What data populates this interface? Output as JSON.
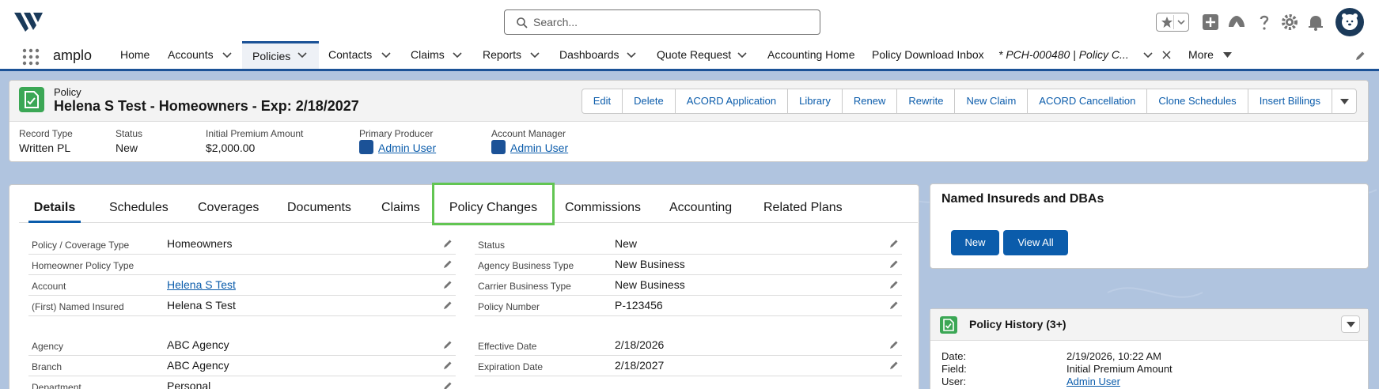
{
  "header": {
    "search_placeholder": "Search..."
  },
  "nav": {
    "app_name": "amplo",
    "items": [
      {
        "label": "Home"
      },
      {
        "label": "Accounts"
      },
      {
        "label": "Policies"
      },
      {
        "label": "Contacts"
      },
      {
        "label": "Claims"
      },
      {
        "label": "Reports"
      },
      {
        "label": "Dashboards"
      },
      {
        "label": "Quote Request"
      },
      {
        "label": "Accounting Home"
      },
      {
        "label": "Policy Download Inbox"
      },
      {
        "label": "* PCH-000480 | Policy C..."
      },
      {
        "label": "More"
      }
    ]
  },
  "record": {
    "object_type": "Policy",
    "name": "Helena S Test - Homeowners - Exp: 2/18/2027",
    "actions": [
      "Edit",
      "Delete",
      "ACORD Application",
      "Library",
      "Renew",
      "Rewrite",
      "New Claim",
      "ACORD Cancellation",
      "Clone Schedules",
      "Insert Billings"
    ],
    "highlights": [
      {
        "label": "Record Type",
        "value": "Written PL"
      },
      {
        "label": "Status",
        "value": "New"
      },
      {
        "label": "Initial Premium Amount",
        "value": "$2,000.00"
      },
      {
        "label": "Primary Producer",
        "value": "Admin User"
      },
      {
        "label": "Account Manager",
        "value": "Admin User"
      }
    ]
  },
  "tabs": [
    "Details",
    "Schedules",
    "Coverages",
    "Documents",
    "Claims",
    "Policy Changes",
    "Commissions",
    "Accounting",
    "Related Plans"
  ],
  "details": {
    "left": [
      {
        "label": "Policy / Coverage Type",
        "value": "Homeowners"
      },
      {
        "label": "Homeowner Policy Type",
        "value": ""
      },
      {
        "label": "Account",
        "value": "Helena S Test"
      },
      {
        "label": "(First) Named Insured",
        "value": "Helena S Test"
      },
      {
        "label": "Agency",
        "value": "ABC Agency"
      },
      {
        "label": "Branch",
        "value": "ABC Agency"
      },
      {
        "label": "Department",
        "value": "Personal"
      }
    ],
    "right": [
      {
        "label": "Status",
        "value": "New"
      },
      {
        "label": "Agency Business Type",
        "value": "New Business"
      },
      {
        "label": "Carrier Business Type",
        "value": "New Business"
      },
      {
        "label": "Policy Number",
        "value": "P-123456"
      },
      {
        "label": "Effective Date",
        "value": "2/18/2026"
      },
      {
        "label": "Expiration Date",
        "value": "2/18/2027"
      }
    ]
  },
  "named_insureds": {
    "title": "Named Insureds and DBAs",
    "new_label": "New",
    "view_all_label": "View All"
  },
  "policy_history": {
    "title": "Policy History (3+)",
    "rows": [
      {
        "label": "Date:",
        "value": "2/19/2026, 10:22 AM"
      },
      {
        "label": "Field:",
        "value": "Initial Premium Amount"
      },
      {
        "label": "User:",
        "value": "Admin User"
      }
    ]
  },
  "colors": {
    "brand_blue": "#0b5cab",
    "nav_accent": "#1b5297",
    "policy_icon_green": "#3ba755",
    "tab_highlight_green": "#62c552",
    "background": "#b0c4df"
  }
}
